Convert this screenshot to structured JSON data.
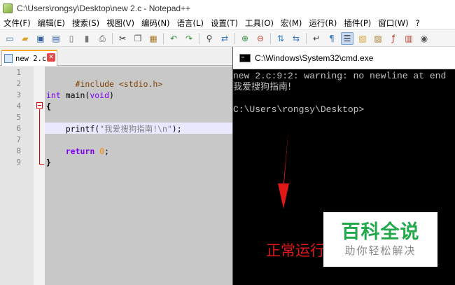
{
  "window": {
    "title": "C:\\Users\\rongsy\\Desktop\\new 2.c - Notepad++"
  },
  "menubar": {
    "items": [
      "文件(F)",
      "编辑(E)",
      "搜索(S)",
      "视图(V)",
      "编码(N)",
      "语言(L)",
      "设置(T)",
      "工具(O)",
      "宏(M)",
      "运行(R)",
      "插件(P)",
      "窗口(W)",
      "?"
    ]
  },
  "toolbar": {
    "icons": [
      "new-file-icon",
      "open-file-icon",
      "save-icon",
      "save-all-icon",
      "close-icon",
      "close-all-icon",
      "print-icon",
      "cut-icon",
      "copy-icon",
      "paste-icon",
      "undo-icon",
      "redo-icon",
      "find-icon",
      "replace-icon",
      "zoom-in-icon",
      "zoom-out-icon",
      "sync-vertical-icon",
      "sync-horizontal-icon",
      "word-wrap-icon",
      "all-chars-icon",
      "indent-guide-icon",
      "user-lang-icon",
      "doc-map-icon",
      "function-list-icon",
      "folder-workspace-icon",
      "monitor-icon"
    ]
  },
  "tab": {
    "label": "new 2.c",
    "close_glyph": "✕"
  },
  "editor": {
    "line_numbers": [
      "1",
      "2",
      "3",
      "4",
      "5",
      "6",
      "7",
      "8",
      "9"
    ],
    "lines": {
      "l1_pre": "#include <stdio.h>",
      "l3_type": "int",
      "l3_plain": " main(",
      "l3_void": "void",
      "l3_close": ")",
      "l4_brace": "{",
      "l6_indent": "    ",
      "l6_fn": "printf(",
      "l6_str": "\"我爱搜狗指南!\\n\"",
      "l6_end": ");",
      "l8_indent": "    ",
      "l8_kw": "return",
      "l8_sp": " ",
      "l8_num": "0",
      "l8_end": ";",
      "l9_brace": "}"
    }
  },
  "cmd": {
    "title": "C:\\Windows\\System32\\cmd.exe",
    "lines": [
      "new 2.c:9:2: warning: no newline at end",
      "我爱搜狗指南!",
      "",
      "C:\\Users\\rongsy\\Desktop>"
    ]
  },
  "annotation": {
    "text": "正常运行"
  },
  "watermark": {
    "main": "百科全说",
    "sub": "助你轻松解决"
  },
  "colors": {
    "accent_tab": "#f5a623",
    "annotation_red": "#e01818",
    "watermark_green": "#20a84a"
  }
}
